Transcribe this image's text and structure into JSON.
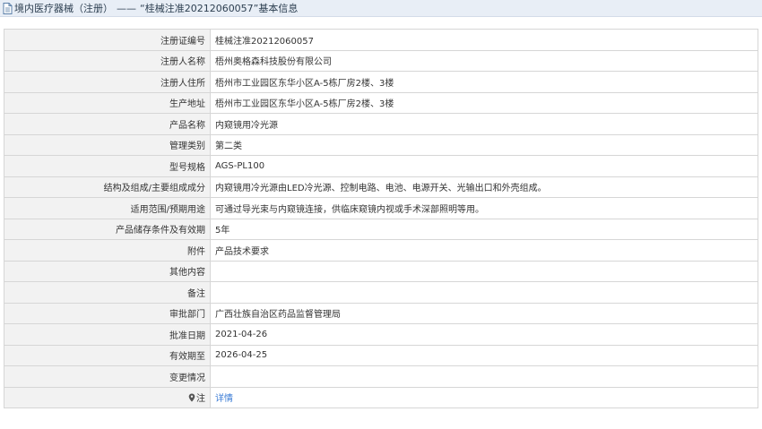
{
  "header": {
    "section": "境内医疗器械（注册）",
    "dash": "——",
    "record_title": "“桂械注准20212060057”基本信息"
  },
  "rows": [
    {
      "label": "注册证编号",
      "value": "桂械注准20212060057"
    },
    {
      "label": "注册人名称",
      "value": "梧州奥格森科技股份有限公司"
    },
    {
      "label": "注册人住所",
      "value": "梧州市工业园区东华小区A-5栋厂房2楼、3楼"
    },
    {
      "label": "生产地址",
      "value": "梧州市工业园区东华小区A-5栋厂房2楼、3楼"
    },
    {
      "label": "产品名称",
      "value": "内窥镜用冷光源"
    },
    {
      "label": "管理类别",
      "value": "第二类"
    },
    {
      "label": "型号规格",
      "value": "AGS-PL100"
    },
    {
      "label": "结构及组成/主要组成成分",
      "value": "内窥镜用冷光源由LED冷光源、控制电路、电池、电源开关、光输出口和外壳组成。"
    },
    {
      "label": "适用范围/预期用途",
      "value": "可通过导光束与内窥镜连接，供临床窥镜内视或手术深部照明等用。"
    },
    {
      "label": "产品储存条件及有效期",
      "value": "5年"
    },
    {
      "label": "附件",
      "value": "产品技术要求"
    },
    {
      "label": "其他内容",
      "value": ""
    },
    {
      "label": "备注",
      "value": ""
    },
    {
      "label": "审批部门",
      "value": "广西壮族自治区药品监督管理局"
    },
    {
      "label": "批准日期",
      "value": "2021-04-26"
    },
    {
      "label": "有效期至",
      "value": "2026-04-25"
    },
    {
      "label": "变更情况",
      "value": ""
    },
    {
      "label": "注",
      "value": "详情",
      "icon": "map-pin-icon",
      "link": true
    }
  ],
  "colors": {
    "header_bg": "#e8eef6",
    "label_bg": "#f2f2f2",
    "border": "#d6d6d6",
    "link": "#3a7bd5"
  }
}
